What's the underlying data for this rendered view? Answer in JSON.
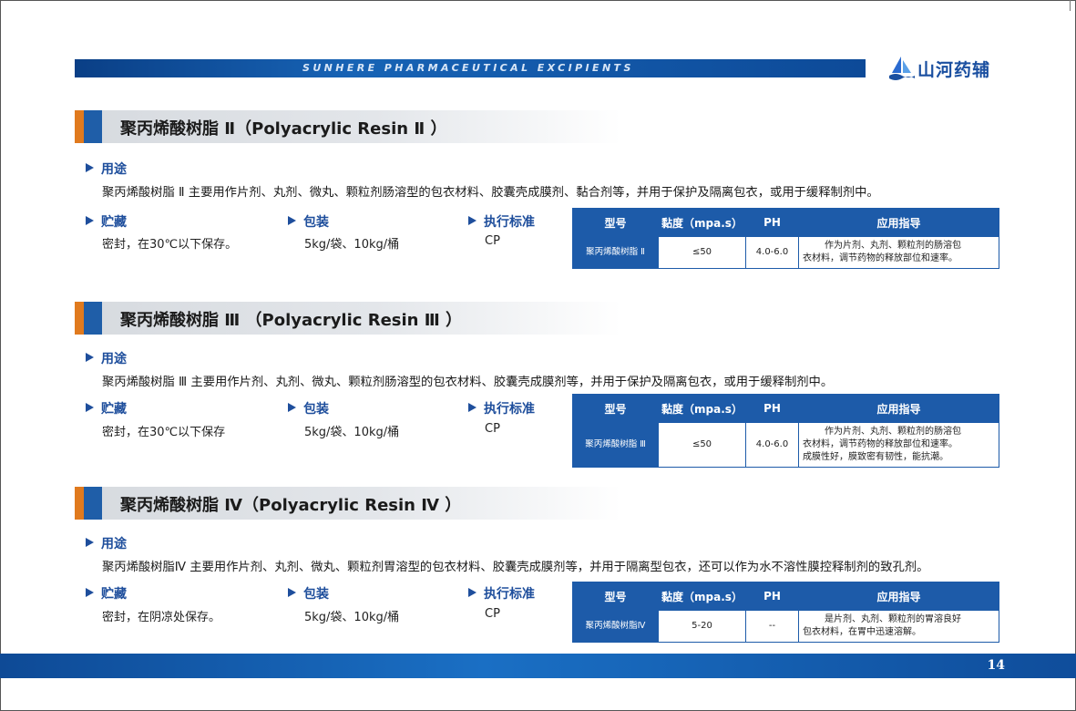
{
  "header": {
    "banner_text": "SUNHERE PHARMACEUTICAL EXCIPIENTS",
    "brand_name": "山河药辅"
  },
  "labels": {
    "usage": "用途",
    "storage": "贮藏",
    "package": "包装",
    "standard": "执行标准"
  },
  "table_headers": {
    "model": "型号",
    "viscosity": "黏度（mpa.s）",
    "ph": "PH",
    "guide": "应用指导"
  },
  "sections": [
    {
      "title": "聚丙烯酸树脂 Ⅱ（Polyacrylic Resin Ⅱ ）",
      "usage": "聚丙烯酸树脂 Ⅱ 主要用作片剂、丸剂、微丸、颗粒剂肠溶型的包衣材料、胶囊壳成膜剂、黏合剂等，并用于保护及隔离包衣，或用于缓释制剂中。",
      "storage": "密封，在30℃以下保存。",
      "package": "5kg/袋、10kg/桶",
      "standard": "CP",
      "row": {
        "model": "聚丙烯酸树脂 Ⅱ",
        "viscosity": "≤50",
        "ph": "4.0-6.0",
        "guide_lines": [
          "作为片剂、丸剂、颗粒剂的肠溶包",
          "衣材料，调节药物的释放部位和速率。"
        ]
      }
    },
    {
      "title": "聚丙烯酸树脂 Ⅲ （Polyacrylic Resin Ⅲ ）",
      "usage": "聚丙烯酸树脂 Ⅲ 主要用作片剂、丸剂、微丸、颗粒剂肠溶型的包衣材料、胶囊壳成膜剂等，并用于保护及隔离包衣，或用于缓释制剂中。",
      "storage": "密封，在30℃以下保存",
      "package": "5kg/袋、10kg/桶",
      "standard": "CP",
      "row": {
        "model": "聚丙烯酸树脂 Ⅲ",
        "viscosity": "≤50",
        "ph": "4.0-6.0",
        "guide_lines": [
          "作为片剂、丸剂、颗粒剂的肠溶包",
          "衣材料，调节药物的释放部位和速率。",
          "成膜性好，膜致密有韧性，能抗潮。"
        ]
      }
    },
    {
      "title": "聚丙烯酸树脂 Ⅳ（Polyacrylic Resin Ⅳ ）",
      "usage": "聚丙烯酸树脂Ⅳ 主要用作片剂、丸剂、微丸、颗粒剂胃溶型的包衣材料、胶囊壳成膜剂等，并用于隔离型包衣，还可以作为水不溶性膜控释制剂的致孔剂。",
      "storage": "密封，在阴凉处保存。",
      "package": "5kg/袋、10kg/桶",
      "standard": "CP",
      "row": {
        "model": "聚丙烯酸树脂Ⅳ",
        "viscosity": "5-20",
        "ph": "--",
        "guide_lines": [
          "是片剂、丸剂、颗粒剂的胃溶良好",
          "包衣材料，在胃中迅速溶解。"
        ]
      }
    }
  ],
  "footer": {
    "page_number": "14"
  },
  "colors": {
    "brand_blue": "#1d5ba9",
    "accent_orange": "#e07a1e"
  }
}
